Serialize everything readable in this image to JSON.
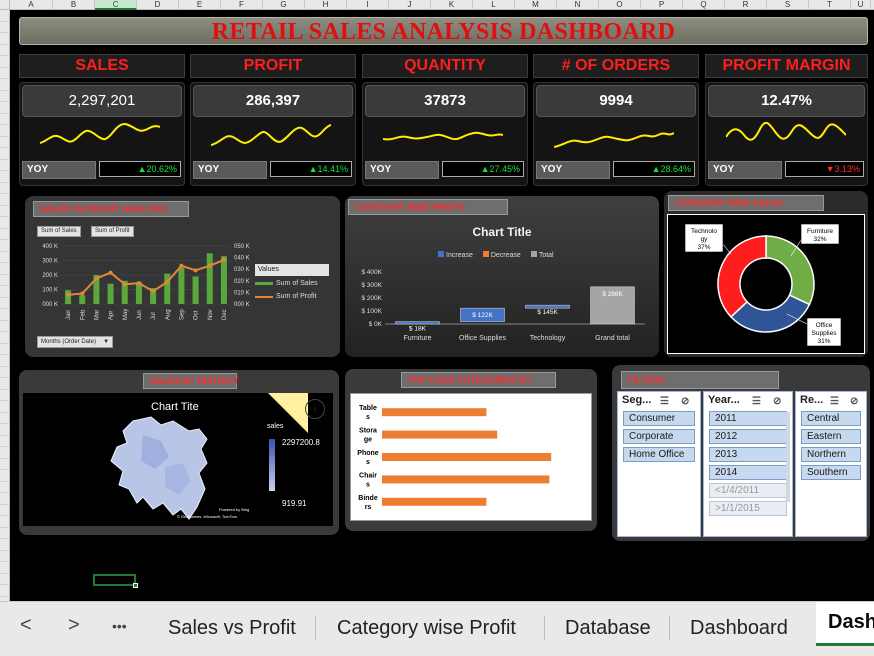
{
  "spreadsheet": {
    "columns": [
      "A",
      "B",
      "C",
      "D",
      "E",
      "F",
      "G",
      "H",
      "I",
      "J",
      "K",
      "L",
      "M",
      "N",
      "O",
      "P",
      "Q",
      "R",
      "S",
      "T",
      "U"
    ],
    "selected_column": "C"
  },
  "title": "RETAIL SALES ANALYSIS DASHBOARD",
  "kpis": [
    {
      "label": "SALES",
      "value": "2,297,201",
      "yoy_label": "YOY",
      "yoy_change": "▲20.62%",
      "direction": "up"
    },
    {
      "label": "PROFIT",
      "value": "286,397",
      "yoy_label": "YOY",
      "yoy_change": "▲14.41%",
      "direction": "up"
    },
    {
      "label": "QUANTITY",
      "value": "37873",
      "yoy_label": "YOY",
      "yoy_change": "▲27.45%",
      "direction": "up"
    },
    {
      "label": "# OF ORDERS",
      "value": "9994",
      "yoy_label": "YOY",
      "yoy_change": "▲28.64%",
      "direction": "up"
    },
    {
      "label": "PROFIT MARGIN",
      "value": "12.47%",
      "yoy_label": "YOY",
      "yoy_change": "▼3.13%",
      "direction": "down"
    }
  ],
  "sales_vs_profit": {
    "tag": "SALES VS PROFIT ANALYSIS",
    "buttons": [
      "Sum of Sales",
      "Sum of Profit"
    ],
    "legend_title": "Values",
    "legend": [
      "Sum of Sales",
      "Sum of Profit"
    ],
    "filter_button": "Months (Order Date)",
    "left_ticks": [
      "400 K",
      "300 K",
      "200 K",
      "100 K",
      "000 K"
    ],
    "right_ticks": [
      "050 K",
      "040 K",
      "030 K",
      "020 K",
      "010 K",
      "000 K"
    ]
  },
  "category_profit": {
    "tag": "CATEGORY WISE  PROFIT",
    "chart_title": "Chart Title",
    "legend": [
      "Increase",
      "Decrease",
      "Total"
    ],
    "y_ticks": [
      "$ 400K",
      "$ 300K",
      "$ 200K",
      "$ 100K",
      "$ 0K"
    ]
  },
  "category_sales": {
    "tag": "CATEGORY WISE  SALES"
  },
  "district": {
    "tag": "SALES BY DISTRICT",
    "chart_title": "Chart Tite",
    "legend_title": "sales",
    "max_label": "2297200.8",
    "min_label": "919.91",
    "info": "i",
    "powered": "Powered by Bing",
    "credits": "© GeoNames, Microsoft, TomTom"
  },
  "top5": {
    "tag": "TOP 5 SUB CATEGORIES BY"
  },
  "filters": {
    "tag": "FILTERS",
    "segment": {
      "title": "Seg...",
      "items": [
        "Consumer",
        "Corporate",
        "Home Office"
      ]
    },
    "year": {
      "title": "Year...",
      "items": [
        "2011",
        "2012",
        "2013",
        "2014"
      ],
      "dim_items": [
        "<1/4/2011",
        ">1/1/2015"
      ]
    },
    "region": {
      "title": "Re...",
      "items": [
        "Central",
        "Eastern",
        "Northern",
        "Southern"
      ]
    }
  },
  "tabs": {
    "nav_prev": "<",
    "nav_next": ">",
    "more": "•••",
    "items": [
      "Sales vs Profit",
      "Category wise Profit",
      "Database",
      "Dashboard"
    ],
    "active": "Dash"
  },
  "colors": {
    "accent_red": "#ff1e1e",
    "spark_yellow": "#ffee00",
    "up_green": "#19e03a",
    "bar_green": "#5aa83c",
    "line_orange": "#e0883a",
    "increase_blue": "#4472c4",
    "decrease_orange": "#ed7d31",
    "total_gray": "#a5a5a5"
  },
  "chart_data": [
    {
      "type": "bar",
      "title": "",
      "categories": [
        "Jan",
        "Feb",
        "Mar",
        "Apr",
        "May",
        "Jun",
        "Jul",
        "Aug",
        "Sep",
        "Oct",
        "Nov",
        "Dec"
      ],
      "series": [
        {
          "name": "Sum of Sales",
          "values": [
            95000,
            60000,
            200000,
            140000,
            160000,
            150000,
            110000,
            210000,
            250000,
            190000,
            350000,
            330000
          ]
        },
        {
          "name": "Sum of Profit",
          "values": [
            8000,
            9000,
            22000,
            27000,
            17000,
            18000,
            11000,
            19000,
            33000,
            29000,
            33000,
            38000
          ]
        }
      ],
      "ylim": [
        0,
        400000
      ],
      "y2lim": [
        0,
        50000
      ]
    },
    {
      "type": "bar",
      "title": "Chart Title",
      "categories": [
        "Furniture",
        "Office Supplies",
        "Technology",
        "Grand total"
      ],
      "values": [
        18000,
        122000,
        145000,
        286000
      ],
      "data_labels": [
        "$ 18K",
        "$ 122K",
        "$ 145K",
        "$ 286K"
      ],
      "ylim": [
        0,
        400000
      ]
    },
    {
      "type": "pie",
      "labels": [
        "Furniture",
        "Office Supplies",
        "Technology"
      ],
      "values": [
        32,
        31,
        37
      ]
    },
    {
      "type": "bar",
      "title": "",
      "categories": [
        "Tables",
        "Storage",
        "Phones",
        "Chairs",
        "Binders"
      ],
      "values": [
        58,
        64,
        94,
        93,
        58
      ]
    }
  ]
}
